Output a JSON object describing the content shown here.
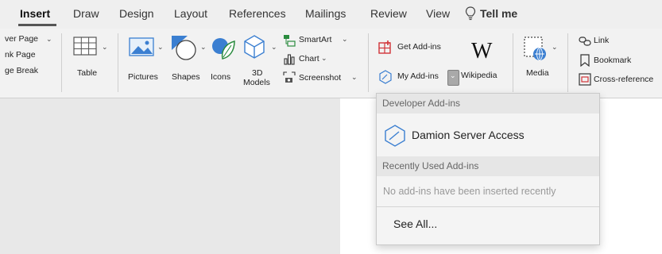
{
  "tabs": [
    {
      "label": "Insert",
      "active": true
    },
    {
      "label": "Draw"
    },
    {
      "label": "Design"
    },
    {
      "label": "Layout"
    },
    {
      "label": "References"
    },
    {
      "label": "Mailings"
    },
    {
      "label": "Review"
    },
    {
      "label": "View"
    },
    {
      "label": "Tell me"
    }
  ],
  "ribbon": {
    "pages": {
      "cover": "ver Page",
      "blank": "nk Page",
      "break": "ge Break"
    },
    "table": "Table",
    "pictures": "Pictures",
    "shapes": "Shapes",
    "icons": "Icons",
    "models_line1": "3D",
    "models_line2": "Models",
    "smartart": "SmartArt",
    "chart": "Chart",
    "screenshot": "Screenshot",
    "get_addins": "Get Add-ins",
    "my_addins": "My Add-ins",
    "wikipedia": "Wikipedia",
    "media": "Media",
    "link": "Link",
    "bookmark": "Bookmark",
    "crossref": "Cross-reference"
  },
  "dropdown": {
    "developer_header": "Developer Add-ins",
    "developer_items": [
      {
        "label": "Damion Server Access"
      }
    ],
    "recent_header": "Recently Used Add-ins",
    "recent_empty": "No add-ins have been inserted recently",
    "see_all": "See All..."
  },
  "colors": {
    "accent_red": "#d13438",
    "icon_blue": "#3b7fd1",
    "text_gray": "#999999"
  }
}
